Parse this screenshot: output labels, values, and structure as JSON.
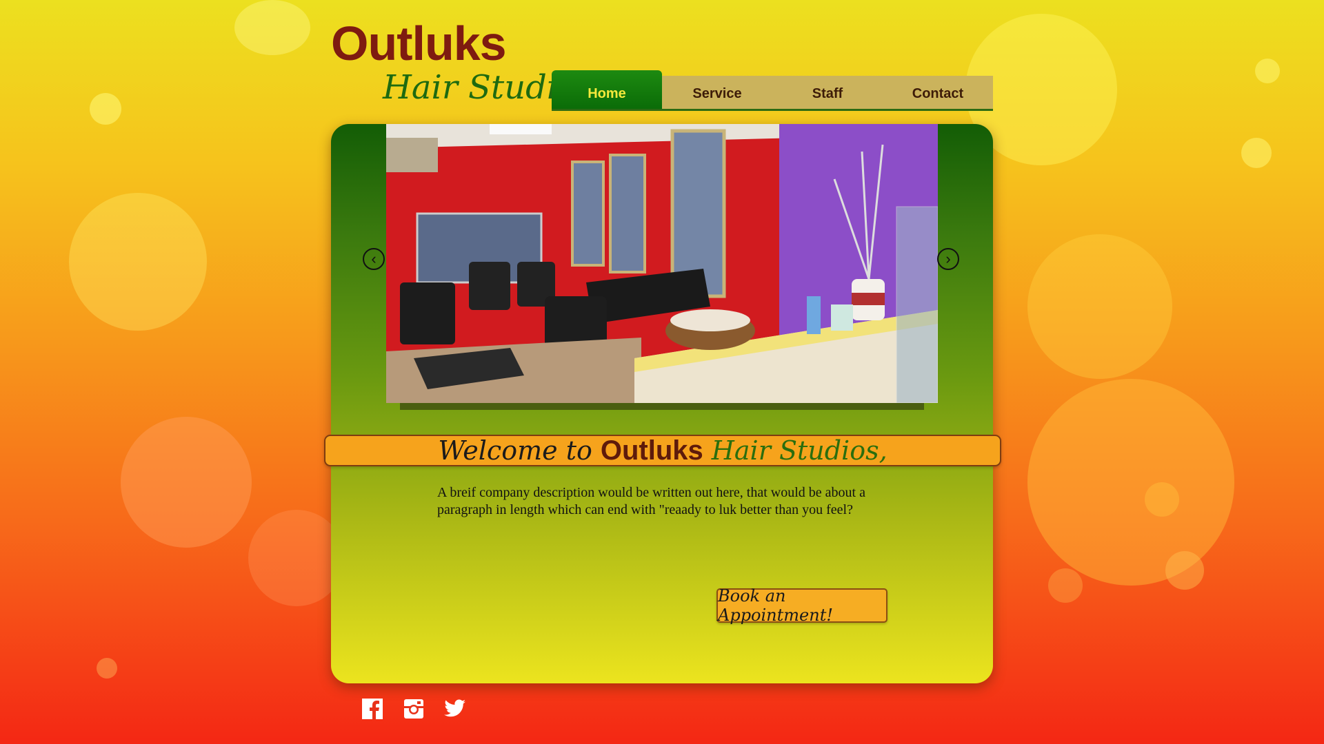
{
  "brand": {
    "title": "Outluks",
    "subtitle": "Hair Studios"
  },
  "nav": {
    "items": [
      {
        "label": "Home",
        "active": true
      },
      {
        "label": "Service",
        "active": false
      },
      {
        "label": "Staff",
        "active": false
      },
      {
        "label": "Contact",
        "active": false
      }
    ]
  },
  "slider": {
    "prev_icon": "chevron-left-icon",
    "next_icon": "chevron-right-icon"
  },
  "welcome": {
    "part1": "Welcome to",
    "part2": "Outluks",
    "part3": "Hair Studios,"
  },
  "description": "A breif company description would be written out here, that would be about a paragraph in length which can end with \"reaady to luk better than you feel?",
  "cta": {
    "label": "Book an Appointment!"
  },
  "social": {
    "icons": [
      "facebook-icon",
      "instagram-icon",
      "twitter-icon"
    ]
  },
  "colors": {
    "brand_dark_red": "#7e1b10",
    "brand_green": "#1e6a10",
    "nav_active": "#0b6c08",
    "cta_orange": "#f6ad23"
  }
}
